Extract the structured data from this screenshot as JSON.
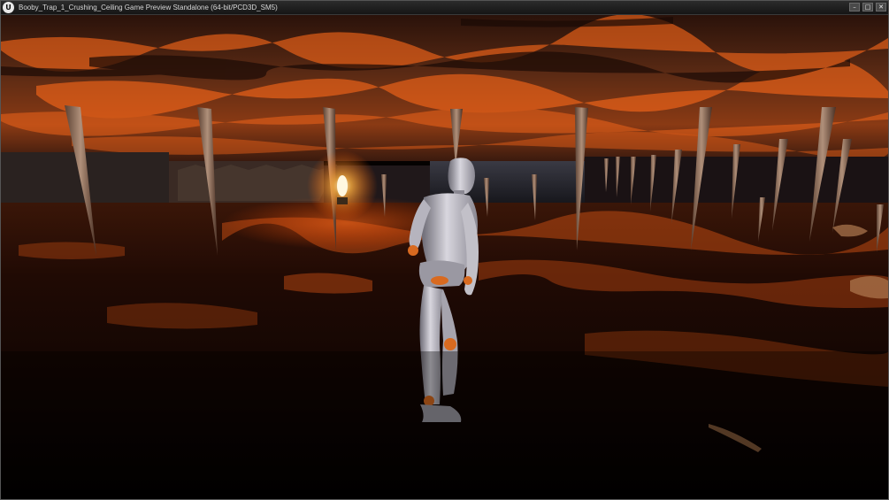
{
  "window": {
    "title": "Booby_Trap_1_Crushing_Ceiling Game Preview Standalone (64-bit/PCD3D_SM5)",
    "logo_text": "U",
    "buttons": {
      "minimize_glyph": "–",
      "maximize_glyph": "□",
      "close_glyph": "✕"
    }
  },
  "scene": {
    "description_icon": "game-viewport",
    "palette": {
      "lava": "#ff6a1a",
      "rock_dark": "#1a0c06",
      "rock_mid": "#4a2a1a",
      "spike": "#a08070",
      "character": "#c9c6cf",
      "torch": "#ffe7a8"
    }
  }
}
